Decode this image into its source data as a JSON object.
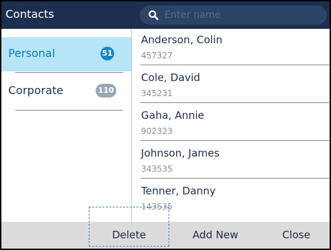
{
  "header": {
    "title": "Contacts",
    "search_placeholder": "Enter name",
    "search_value": ""
  },
  "sidebar": {
    "items": [
      {
        "label": "Personal",
        "count": "51",
        "selected": true
      },
      {
        "label": "Corporate",
        "count": "110",
        "selected": false
      }
    ]
  },
  "contacts": [
    {
      "name": "Anderson, Colin",
      "number": "457327"
    },
    {
      "name": "Cole, David",
      "number": "345231"
    },
    {
      "name": "Gaha, Annie",
      "number": "902323"
    },
    {
      "name": "Johnson, James",
      "number": "343535"
    },
    {
      "name": "Tenner, Danny",
      "number": "143535"
    }
  ],
  "softkeys": {
    "delete": "Delete",
    "add_new": "Add New",
    "close": "Close"
  },
  "colors": {
    "header_bg": "#1c2f4f",
    "selected_bg": "#b8e4f7",
    "accent": "#1a86c8",
    "footer_bg": "#dcdcdc"
  }
}
